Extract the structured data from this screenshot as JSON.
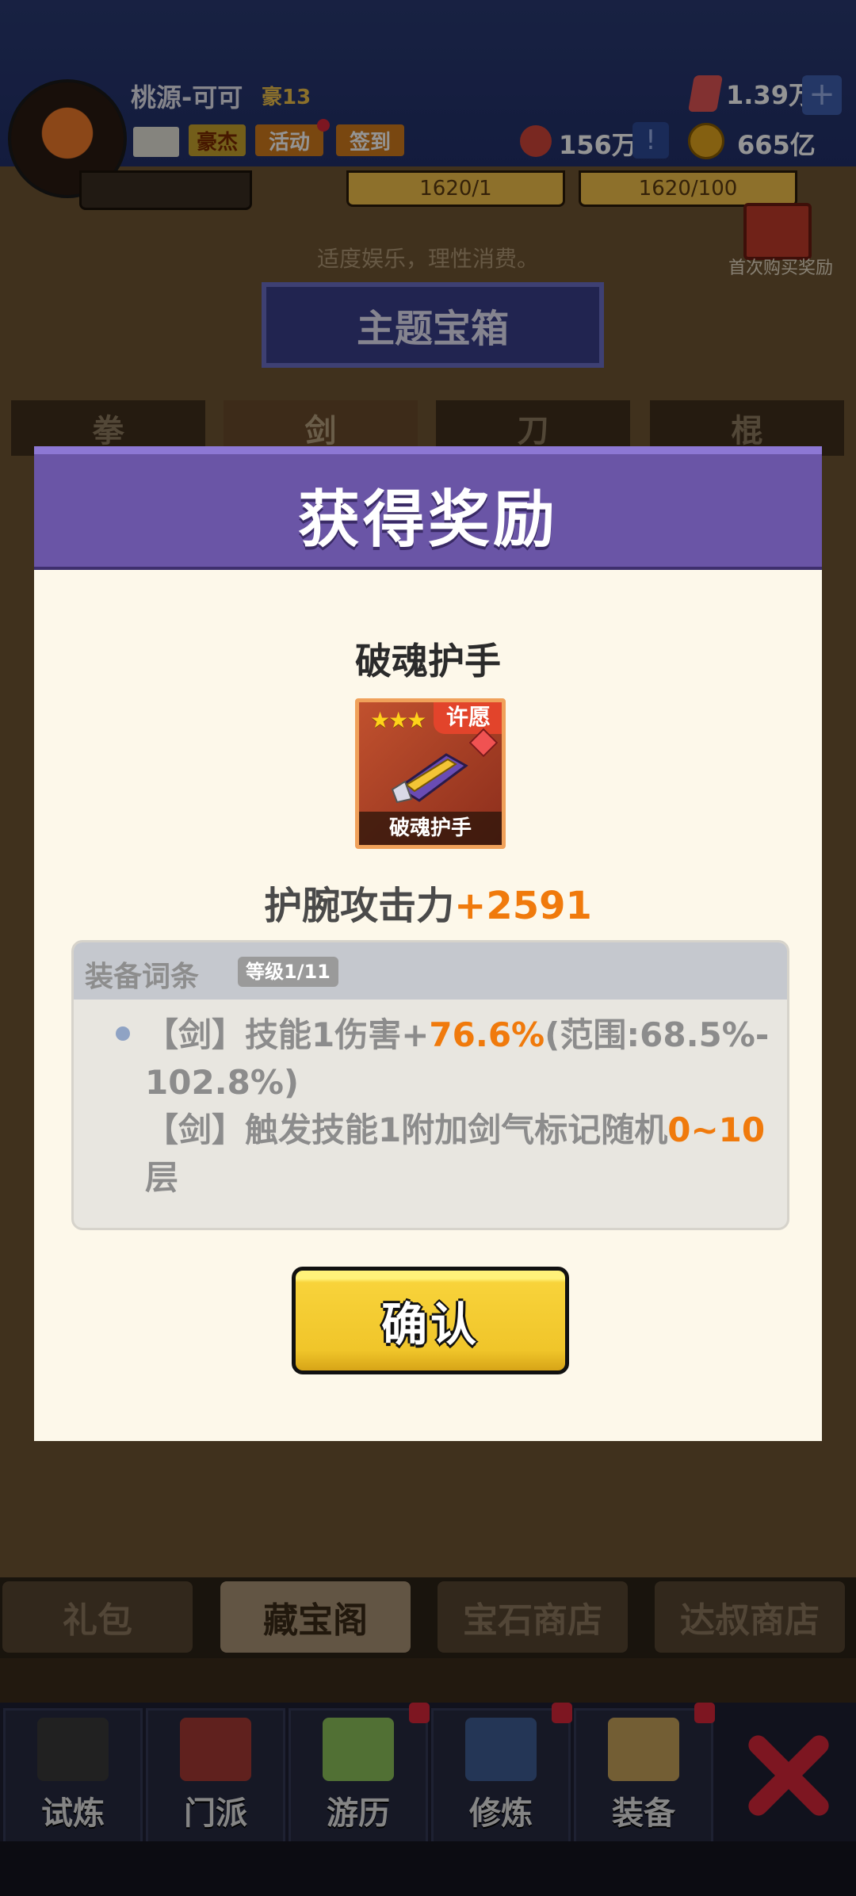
{
  "header": {
    "player_name": "桃源-可可",
    "rank_tag": "豪13",
    "buttons": [
      "豪杰",
      "活动",
      "签到"
    ],
    "gem_amount": "1.39万",
    "ticket_amount": "156万",
    "gold_amount": "665亿"
  },
  "shop": {
    "card_prices": [
      "1620/1",
      "1620/100"
    ],
    "slogan": "适度娱乐，理性消费。",
    "first_purchase_label": "首次购买奖励",
    "banner_title": "主题宝箱",
    "categories": [
      "拳",
      "剑",
      "刀",
      "棍"
    ],
    "active_category": "剑",
    "tabs": [
      "礼包",
      "藏宝阁",
      "宝石商店",
      "达叔商店"
    ],
    "active_tab": "藏宝阁"
  },
  "bottom_nav": {
    "items": [
      "试炼",
      "门派",
      "游历",
      "修炼",
      "装备"
    ]
  },
  "reward_modal": {
    "title": "获得奖励",
    "item_name": "破魂护手",
    "item_badge": "许愿",
    "item_stars": "★★★",
    "item_icon_label": "破魂护手",
    "stat_label": "护腕攻击力",
    "stat_value": "+2591",
    "affix_title": "装备词条",
    "affix_level": "等级1/11",
    "affix_lines": {
      "l1_prefix": "【剑】技能1伤害+",
      "l1_value": "76.6%",
      "l1_range": "(范围:68.5%-102.8%)",
      "l2_prefix": "【剑】触发技能1附加剑气标记随机",
      "l2_value": "0~10",
      "l2_suffix": "层"
    },
    "confirm_label": "确认"
  }
}
